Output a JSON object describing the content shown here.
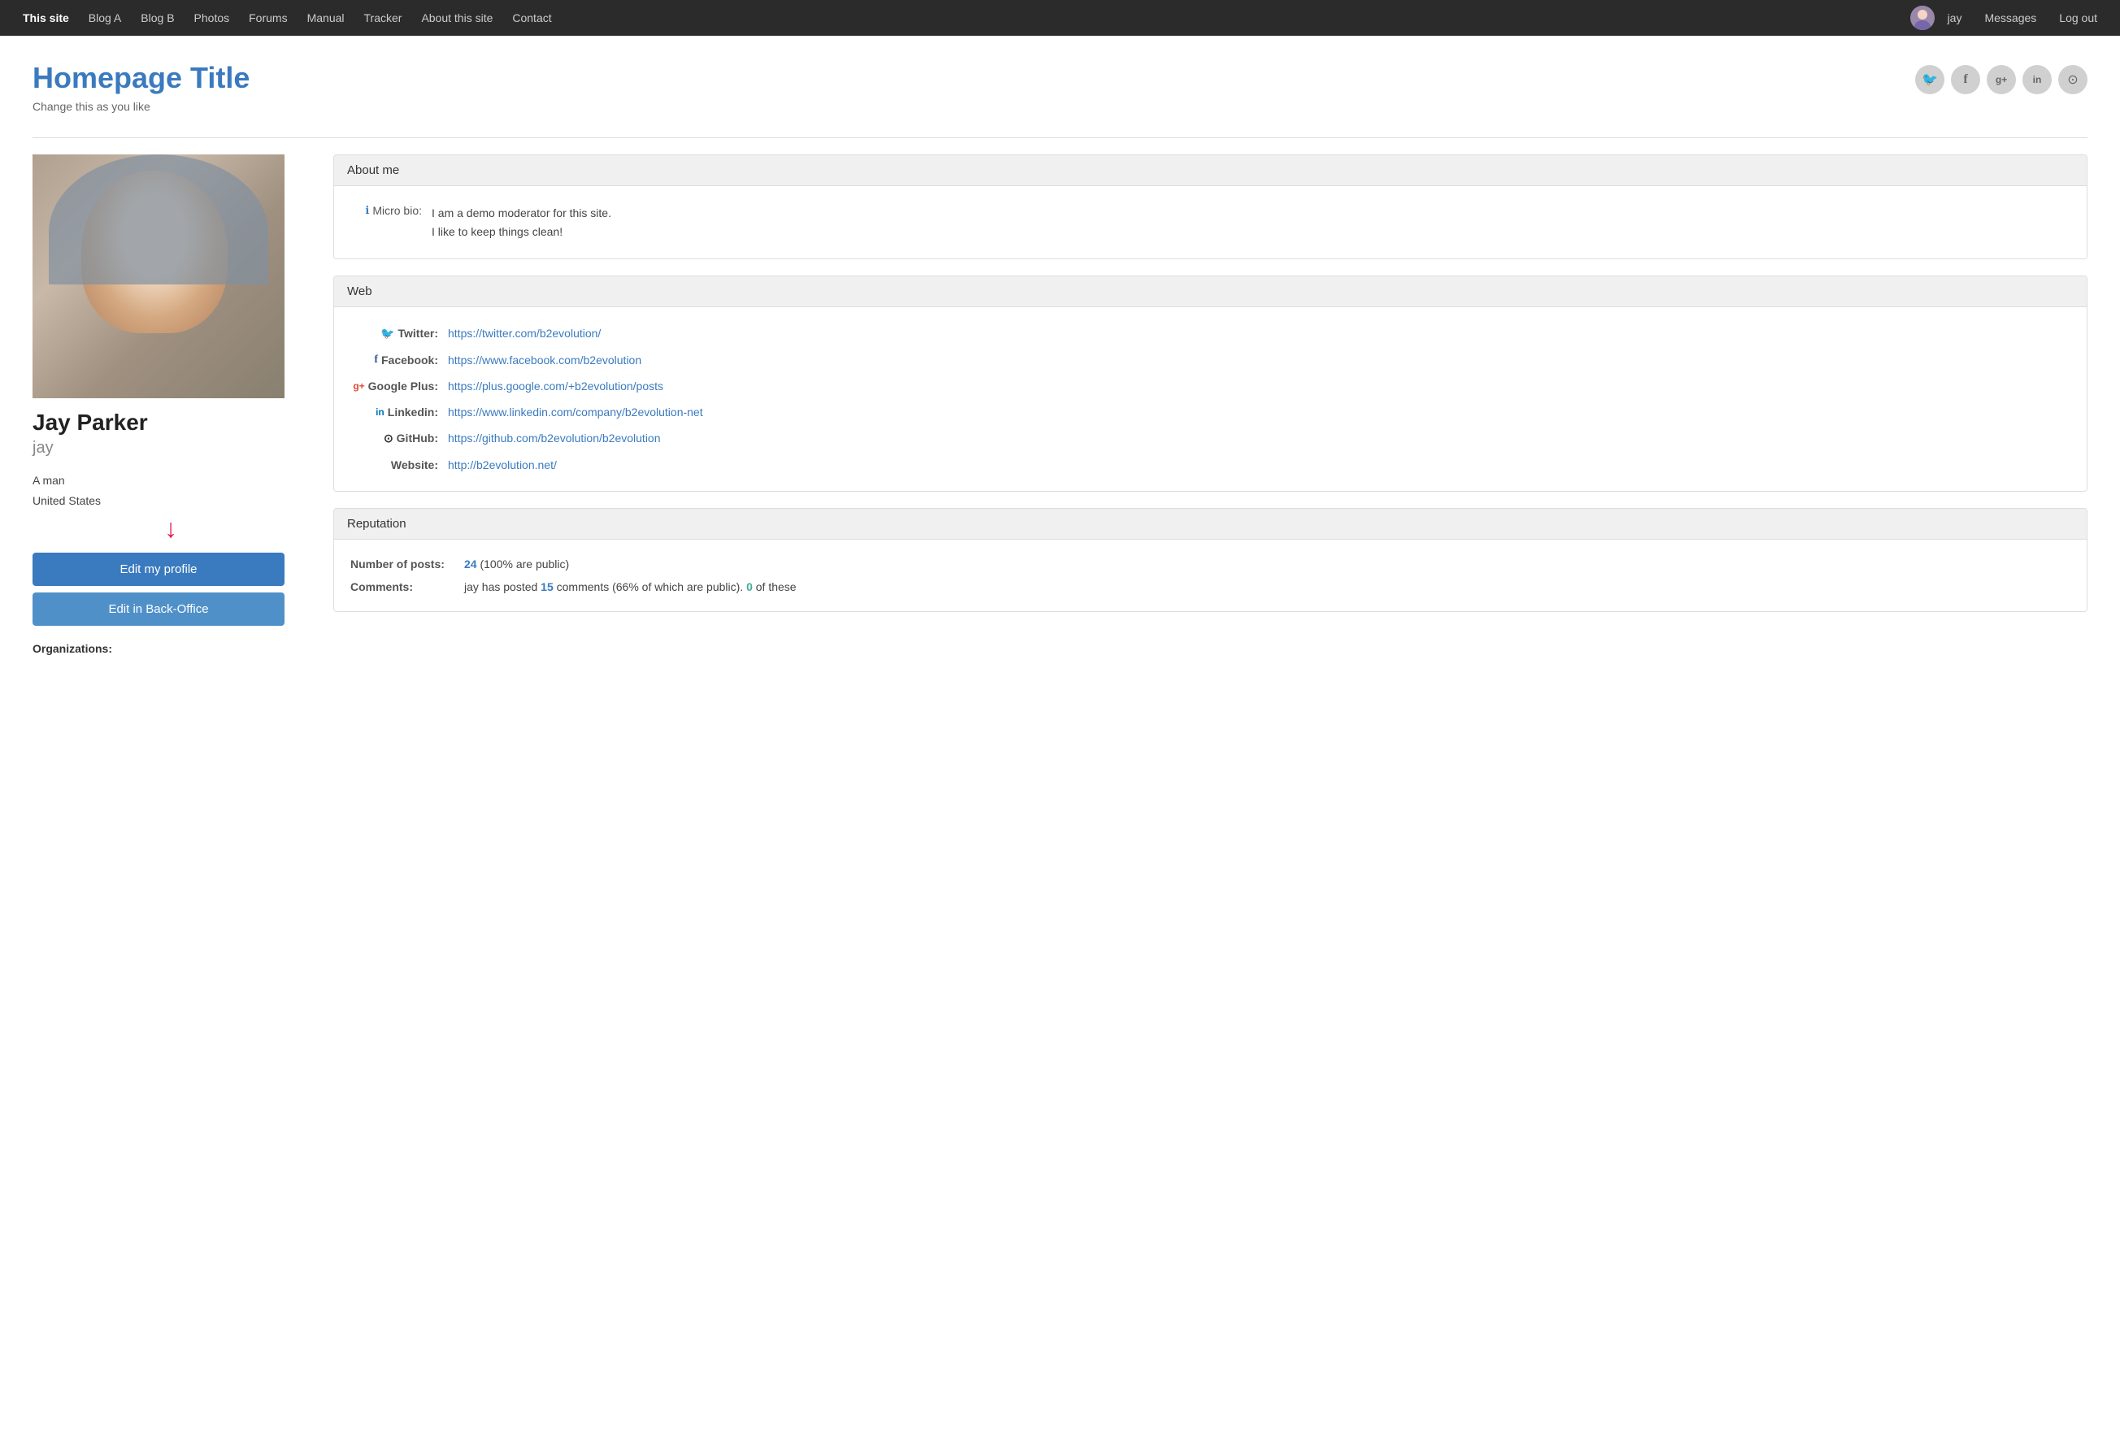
{
  "nav": {
    "brand": "This site",
    "links": [
      {
        "label": "Blog A",
        "href": "#"
      },
      {
        "label": "Blog B",
        "href": "#"
      },
      {
        "label": "Photos",
        "href": "#"
      },
      {
        "label": "Forums",
        "href": "#"
      },
      {
        "label": "Manual",
        "href": "#"
      },
      {
        "label": "Tracker",
        "href": "#"
      },
      {
        "label": "About this site",
        "href": "#"
      },
      {
        "label": "Contact",
        "href": "#"
      }
    ],
    "user": {
      "name": "jay",
      "messages_label": "Messages",
      "logout_label": "Log out"
    }
  },
  "header": {
    "title": "Homepage Title",
    "subtitle": "Change this as you like"
  },
  "social_icons": [
    {
      "name": "twitter-icon",
      "symbol": "🐦"
    },
    {
      "name": "facebook-icon",
      "symbol": "f"
    },
    {
      "name": "googleplus-icon",
      "symbol": "g+"
    },
    {
      "name": "linkedin-icon",
      "symbol": "in"
    },
    {
      "name": "github-icon",
      "symbol": "⊙"
    }
  ],
  "profile": {
    "full_name": "Jay Parker",
    "handle": "jay",
    "gender": "A man",
    "location": "United States",
    "edit_profile_label": "Edit my profile",
    "edit_backoffice_label": "Edit in Back-Office",
    "organizations_label": "Organizations:"
  },
  "about_me": {
    "section_title": "About me",
    "micro_bio_label": "Micro bio:",
    "micro_bio_line1": "I am a demo moderator for this site.",
    "micro_bio_line2": "I like to keep things clean!"
  },
  "web": {
    "section_title": "Web",
    "items": [
      {
        "label": "Twitter:",
        "icon": "twitter-web-icon",
        "url": "https://twitter.com/b2evolution/",
        "icon_symbol": "🐦"
      },
      {
        "label": "Facebook:",
        "icon": "facebook-web-icon",
        "url": "https://www.facebook.com/b2evolution",
        "icon_symbol": "f"
      },
      {
        "label": "Google Plus:",
        "icon": "googleplus-web-icon",
        "url": "https://plus.google.com/+b2evolution/posts",
        "icon_symbol": "g+"
      },
      {
        "label": "Linkedin:",
        "icon": "linkedin-web-icon",
        "url": "https://www.linkedin.com/company/b2evolution-net",
        "icon_symbol": "in"
      },
      {
        "label": "GitHub:",
        "icon": "github-web-icon",
        "url": "https://github.com/b2evolution/b2evolution",
        "icon_symbol": "⊙"
      },
      {
        "label": "Website:",
        "icon": "website-icon",
        "url": "http://b2evolution.net/",
        "icon_symbol": ""
      }
    ]
  },
  "reputation": {
    "section_title": "Reputation",
    "posts_label": "Number of posts:",
    "posts_count": "24",
    "posts_suffix": "(100% are public)",
    "comments_label": "Comments:",
    "comments_text": "jay has posted ",
    "comments_count": "15",
    "comments_suffix": " comments (66% of which are public). ",
    "comments_count2": "0",
    "comments_suffix2": " of these"
  }
}
